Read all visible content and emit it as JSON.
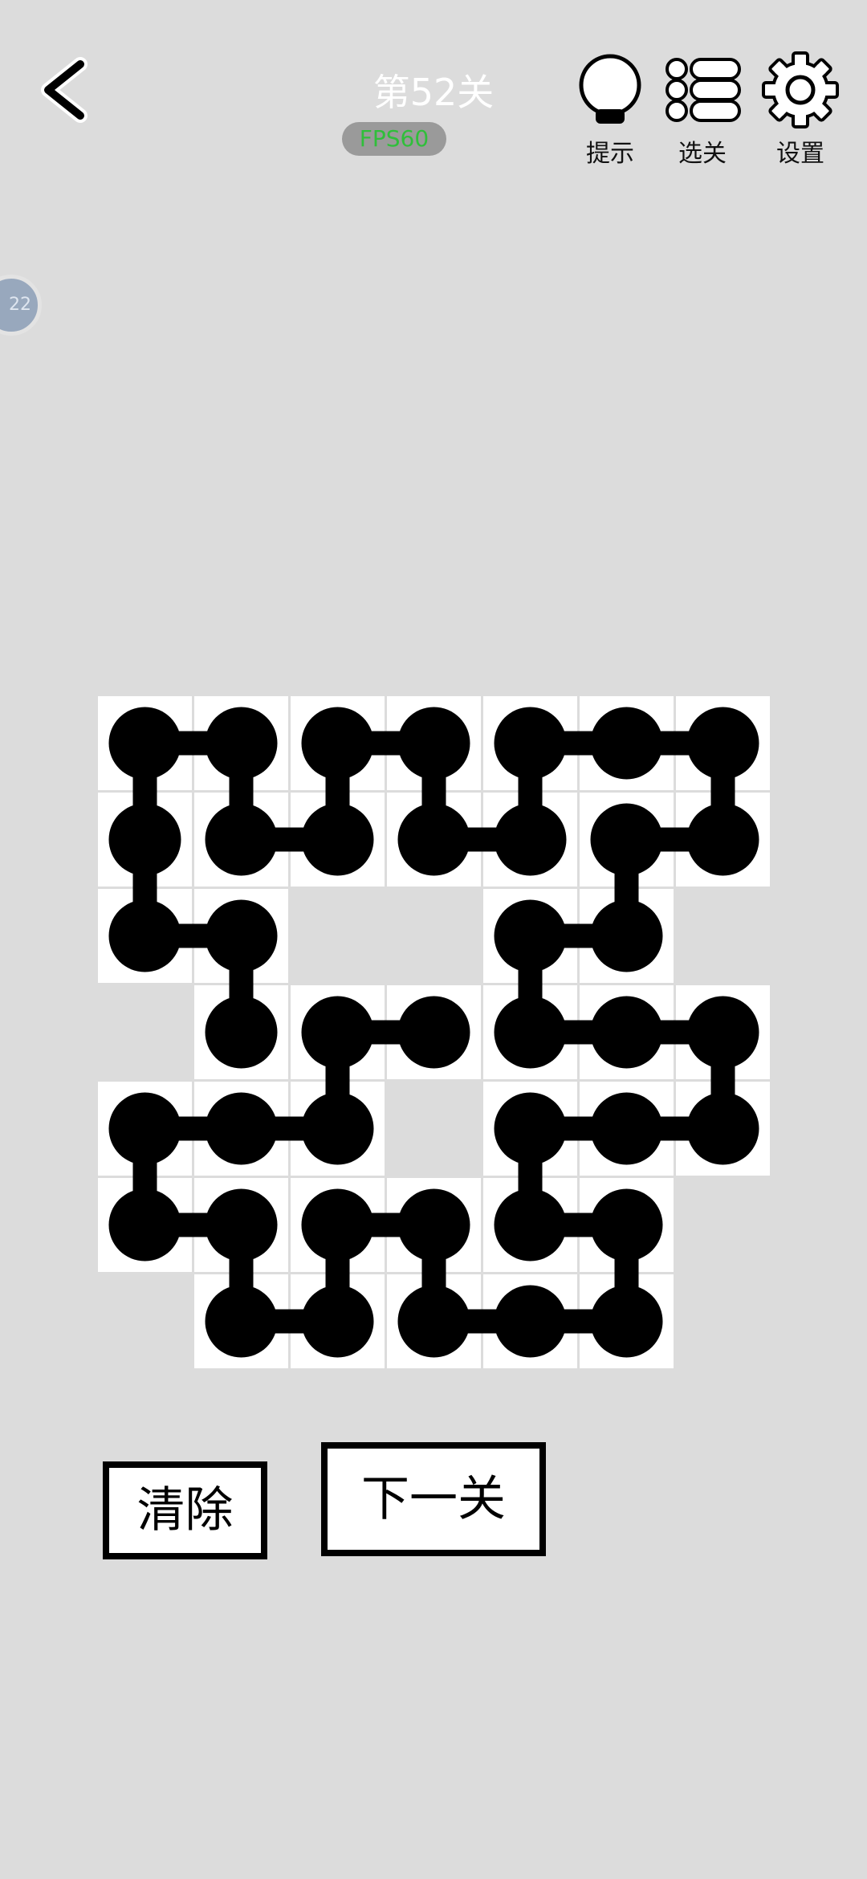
{
  "header": {
    "title": "第52关",
    "fps": "FPS60",
    "hint_label": "提示",
    "levels_label": "选关",
    "settings_label": "设置"
  },
  "side_badge": {
    "text": "22"
  },
  "board": {
    "cols": 7,
    "rows": 7,
    "cells": [
      [
        0,
        0
      ],
      [
        1,
        0
      ],
      [
        2,
        0
      ],
      [
        3,
        0
      ],
      [
        4,
        0
      ],
      [
        5,
        0
      ],
      [
        6,
        0
      ],
      [
        0,
        1
      ],
      [
        1,
        1
      ],
      [
        2,
        1
      ],
      [
        3,
        1
      ],
      [
        4,
        1
      ],
      [
        5,
        1
      ],
      [
        6,
        1
      ],
      [
        0,
        2
      ],
      [
        1,
        2
      ],
      [
        4,
        2
      ],
      [
        5,
        2
      ],
      [
        1,
        3
      ],
      [
        2,
        3
      ],
      [
        3,
        3
      ],
      [
        4,
        3
      ],
      [
        5,
        3
      ],
      [
        6,
        3
      ],
      [
        0,
        4
      ],
      [
        1,
        4
      ],
      [
        2,
        4
      ],
      [
        4,
        4
      ],
      [
        5,
        4
      ],
      [
        6,
        4
      ],
      [
        0,
        5
      ],
      [
        1,
        5
      ],
      [
        2,
        5
      ],
      [
        3,
        5
      ],
      [
        4,
        5
      ],
      [
        5,
        5
      ],
      [
        1,
        6
      ],
      [
        2,
        6
      ],
      [
        3,
        6
      ],
      [
        4,
        6
      ],
      [
        5,
        6
      ]
    ],
    "links": [
      [
        [
          0,
          0
        ],
        [
          1,
          0
        ]
      ],
      [
        [
          0,
          0
        ],
        [
          0,
          1
        ]
      ],
      [
        [
          1,
          0
        ],
        [
          1,
          1
        ]
      ],
      [
        [
          1,
          1
        ],
        [
          2,
          1
        ]
      ],
      [
        [
          2,
          0
        ],
        [
          3,
          0
        ]
      ],
      [
        [
          2,
          0
        ],
        [
          2,
          1
        ]
      ],
      [
        [
          3,
          0
        ],
        [
          3,
          1
        ]
      ],
      [
        [
          3,
          1
        ],
        [
          4,
          1
        ]
      ],
      [
        [
          4,
          0
        ],
        [
          5,
          0
        ]
      ],
      [
        [
          5,
          0
        ],
        [
          6,
          0
        ]
      ],
      [
        [
          4,
          0
        ],
        [
          4,
          1
        ]
      ],
      [
        [
          6,
          0
        ],
        [
          6,
          1
        ]
      ],
      [
        [
          5,
          1
        ],
        [
          6,
          1
        ]
      ],
      [
        [
          5,
          1
        ],
        [
          5,
          2
        ]
      ],
      [
        [
          0,
          1
        ],
        [
          0,
          2
        ]
      ],
      [
        [
          0,
          2
        ],
        [
          1,
          2
        ]
      ],
      [
        [
          1,
          2
        ],
        [
          1,
          3
        ]
      ],
      [
        [
          4,
          2
        ],
        [
          5,
          2
        ]
      ],
      [
        [
          4,
          2
        ],
        [
          4,
          3
        ]
      ],
      [
        [
          2,
          3
        ],
        [
          3,
          3
        ]
      ],
      [
        [
          2,
          3
        ],
        [
          2,
          4
        ]
      ],
      [
        [
          4,
          3
        ],
        [
          5,
          3
        ]
      ],
      [
        [
          5,
          3
        ],
        [
          6,
          3
        ]
      ],
      [
        [
          6,
          3
        ],
        [
          6,
          4
        ]
      ],
      [
        [
          0,
          4
        ],
        [
          1,
          4
        ]
      ],
      [
        [
          1,
          4
        ],
        [
          2,
          4
        ]
      ],
      [
        [
          0,
          4
        ],
        [
          0,
          5
        ]
      ],
      [
        [
          4,
          4
        ],
        [
          5,
          4
        ]
      ],
      [
        [
          5,
          4
        ],
        [
          6,
          4
        ]
      ],
      [
        [
          4,
          4
        ],
        [
          4,
          5
        ]
      ],
      [
        [
          0,
          5
        ],
        [
          1,
          5
        ]
      ],
      [
        [
          1,
          5
        ],
        [
          1,
          6
        ]
      ],
      [
        [
          2,
          5
        ],
        [
          3,
          5
        ]
      ],
      [
        [
          2,
          5
        ],
        [
          2,
          6
        ]
      ],
      [
        [
          1,
          6
        ],
        [
          2,
          6
        ]
      ],
      [
        [
          3,
          5
        ],
        [
          3,
          6
        ]
      ],
      [
        [
          3,
          6
        ],
        [
          4,
          6
        ]
      ],
      [
        [
          4,
          6
        ],
        [
          5,
          6
        ]
      ],
      [
        [
          4,
          5
        ],
        [
          5,
          5
        ]
      ],
      [
        [
          5,
          5
        ],
        [
          5,
          6
        ]
      ]
    ]
  },
  "buttons": {
    "clear": "清除",
    "next": "下一关"
  }
}
